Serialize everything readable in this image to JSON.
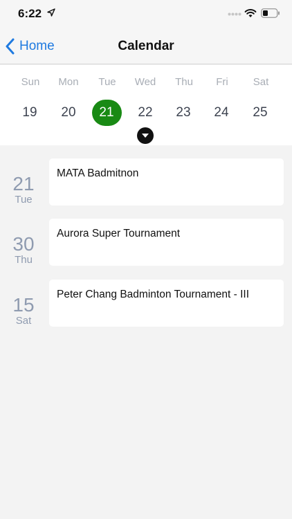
{
  "status_bar": {
    "time": "6:22"
  },
  "nav": {
    "back_label": "Home",
    "title": "Calendar"
  },
  "week": {
    "days": [
      {
        "weekday": "Sun",
        "day": "19"
      },
      {
        "weekday": "Mon",
        "day": "20"
      },
      {
        "weekday": "Tue",
        "day": "21"
      },
      {
        "weekday": "Wed",
        "day": "22"
      },
      {
        "weekday": "Thu",
        "day": "23"
      },
      {
        "weekday": "Fri",
        "day": "24"
      },
      {
        "weekday": "Sat",
        "day": "25"
      }
    ],
    "selected_day": "21"
  },
  "events": [
    {
      "day": "21",
      "weekday": "Tue",
      "title": "MATA Badmitnon"
    },
    {
      "day": "30",
      "weekday": "Thu",
      "title": "Aurora Super Tournament"
    },
    {
      "day": "15",
      "weekday": "Sat",
      "title": "Peter Chang Badminton Tournament - III"
    }
  ],
  "colors": {
    "accent": "#1f7ae0",
    "selected": "#198a14",
    "background": "#f3f3f3",
    "card": "#ffffff"
  },
  "icons": {
    "location": "location-arrow-icon",
    "wifi": "wifi-icon",
    "battery": "battery-icon",
    "back": "chevron-left-icon",
    "expand": "chevron-down-circle-icon"
  }
}
